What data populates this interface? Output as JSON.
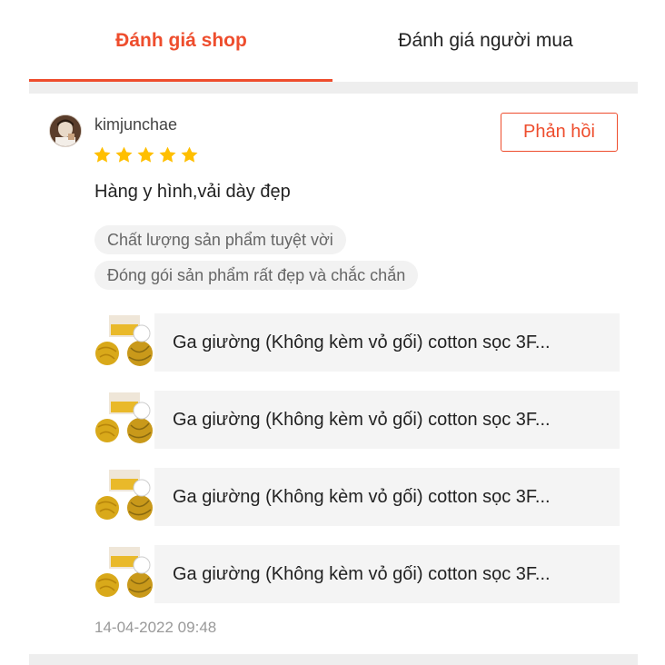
{
  "tabs": [
    {
      "label": "Đánh giá shop",
      "active": true
    },
    {
      "label": "Đánh giá người mua",
      "active": false
    }
  ],
  "review": {
    "username": "kimjunchae",
    "rating": 5,
    "reply_label": "Phản hồi",
    "comment": "Hàng y hình,vải dày đẹp",
    "tags": [
      "Chất lượng sản phẩm tuyệt vời",
      "Đóng gói sản phẩm rất đẹp và chắc chắn"
    ],
    "products": [
      {
        "name": "Ga giường (Không kèm vỏ gối) cotton sọc 3F..."
      },
      {
        "name": "Ga giường (Không kèm vỏ gối) cotton sọc 3F..."
      },
      {
        "name": "Ga giường (Không kèm vỏ gối) cotton sọc 3F..."
      },
      {
        "name": "Ga giường (Không kèm vỏ gối) cotton sọc 3F..."
      }
    ],
    "timestamp": "14-04-2022 09:48"
  },
  "colors": {
    "accent": "#ee4d2d",
    "star": "#ffbf00",
    "divider": "#eeeeee",
    "product_bg": "#f4f4f4"
  },
  "icons": {
    "star": "star-icon",
    "avatar": "user-avatar",
    "product_thumb": "yellow-bedsheet-thumbnail"
  }
}
